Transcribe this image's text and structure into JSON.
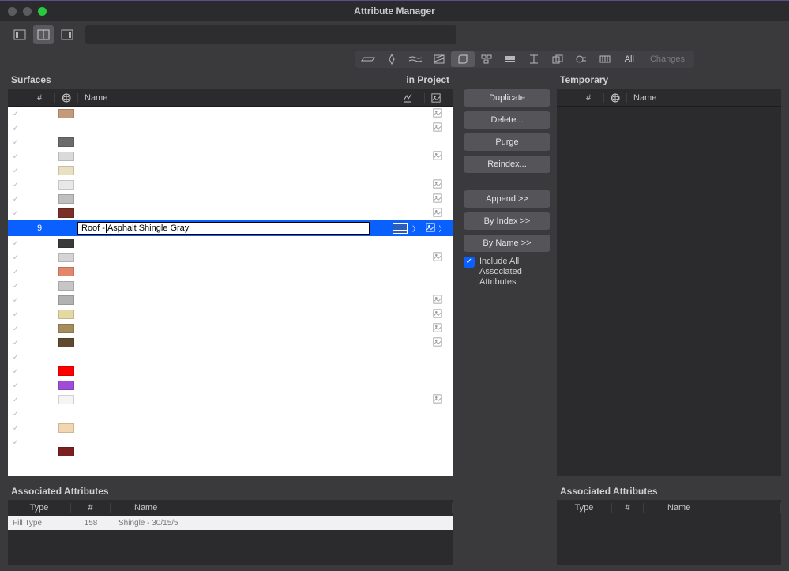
{
  "window": {
    "title": "Attribute Manager"
  },
  "tabstrip": {
    "all": "All",
    "changes": "Changes"
  },
  "panels": {
    "surfaces": "Surfaces",
    "in_project": "in Project",
    "temporary": "Temporary",
    "associated": "Associated Attributes"
  },
  "columns": {
    "num": "#",
    "name": "Name",
    "type": "Type"
  },
  "buttons": {
    "duplicate": "Duplicate",
    "delete": "Delete...",
    "purge": "Purge",
    "reindex": "Reindex...",
    "append": "Append >>",
    "by_index": "By Index >>",
    "by_name": "By Name >>"
  },
  "include_all": "Include All Associated Attributes",
  "selected": {
    "num": "9",
    "edit_left": "Roof -",
    "edit_right": " Asphalt Shingle Gray"
  },
  "surfaces_rows": [
    {
      "check": true,
      "swatch": "#c49a7a",
      "has_img": true
    },
    {
      "check": true,
      "swatch": "",
      "has_img": true
    },
    {
      "check": true,
      "swatch": "#6b6b6b",
      "has_img": false
    },
    {
      "check": true,
      "swatch": "#dadada",
      "has_img": true
    },
    {
      "check": true,
      "swatch": "#e9e0c2",
      "has_img": false
    },
    {
      "check": true,
      "swatch": "#e8e8e8",
      "has_img": true
    },
    {
      "check": true,
      "swatch": "#bfbfbf",
      "has_img": true
    },
    {
      "check": true,
      "swatch": "#7a2f28",
      "has_img": true
    },
    {
      "sel": true
    },
    {
      "check": true,
      "swatch": "#3a3a3a",
      "has_img": false
    },
    {
      "check": true,
      "swatch": "#d4d4d4",
      "has_img": true
    },
    {
      "check": true,
      "swatch": "#e2876a",
      "has_img": false
    },
    {
      "check": true,
      "swatch": "#c6c6c6",
      "has_img": false
    },
    {
      "check": true,
      "swatch": "#b2b2b2",
      "has_img": true
    },
    {
      "check": true,
      "swatch": "#e4d9a5",
      "has_img": true
    },
    {
      "check": true,
      "swatch": "#a48c5c",
      "has_img": true
    },
    {
      "check": true,
      "swatch": "#5f4a30",
      "has_img": true
    },
    {
      "check": true,
      "swatch": "",
      "has_img": false
    },
    {
      "check": true,
      "swatch": "#ff0000",
      "has_img": false
    },
    {
      "check": true,
      "swatch": "#a04cd8",
      "has_img": false
    },
    {
      "check": true,
      "swatch": "#f5f5f5",
      "has_img": true
    },
    {
      "check": true,
      "swatch": "",
      "has_img": false
    },
    {
      "check": true,
      "swatch": "#f2d6b0",
      "has_img": false
    },
    {
      "check": true,
      "swatch": "",
      "has_img": false
    },
    {
      "check": false,
      "swatch": "#7a2020",
      "has_img": false,
      "half": true
    }
  ],
  "assoc_row": {
    "type": "Fill Type",
    "num": "158",
    "name": "Shingle - 30/15/5"
  }
}
